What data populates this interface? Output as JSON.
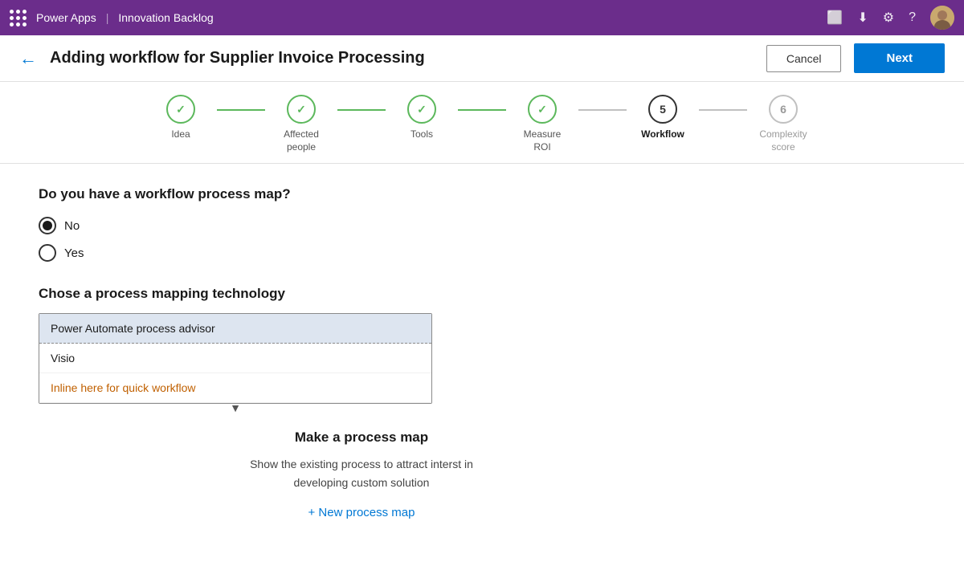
{
  "topbar": {
    "app_name": "Power Apps",
    "separator": "|",
    "project_name": "Innovation Backlog"
  },
  "header": {
    "title": "Adding workflow for Supplier Invoice Processing",
    "cancel_label": "Cancel",
    "next_label": "Next"
  },
  "stepper": {
    "steps": [
      {
        "id": "idea",
        "label": "Idea",
        "state": "done",
        "number": "✓"
      },
      {
        "id": "affected-people",
        "label": "Affected\npeople",
        "state": "done",
        "number": "✓"
      },
      {
        "id": "tools",
        "label": "Tools",
        "state": "done",
        "number": "✓"
      },
      {
        "id": "measure-roi",
        "label": "Measure\nROI",
        "state": "done",
        "number": "✓"
      },
      {
        "id": "workflow",
        "label": "Workflow",
        "state": "active",
        "number": "5"
      },
      {
        "id": "complexity-score",
        "label": "Complexity\nscore",
        "state": "inactive",
        "number": "6"
      }
    ]
  },
  "form": {
    "question": "Do you have a workflow process map?",
    "radio_options": [
      {
        "id": "no",
        "label": "No",
        "checked": true
      },
      {
        "id": "yes",
        "label": "Yes",
        "checked": false
      }
    ],
    "process_tech_label": "Chose a process mapping technology",
    "dropdown_options": [
      {
        "id": "power-automate",
        "label": "Power Automate process advisor",
        "selected": true
      },
      {
        "id": "visio",
        "label": "Visio",
        "selected": false
      },
      {
        "id": "inline",
        "label": "Inline here for quick workflow",
        "selected": false,
        "special": true
      }
    ],
    "process_map_title": "Make a process map",
    "process_map_desc": "Show the existing process to attract interst in\ndeveloping custom solution",
    "new_process_label": "+ New process map"
  }
}
